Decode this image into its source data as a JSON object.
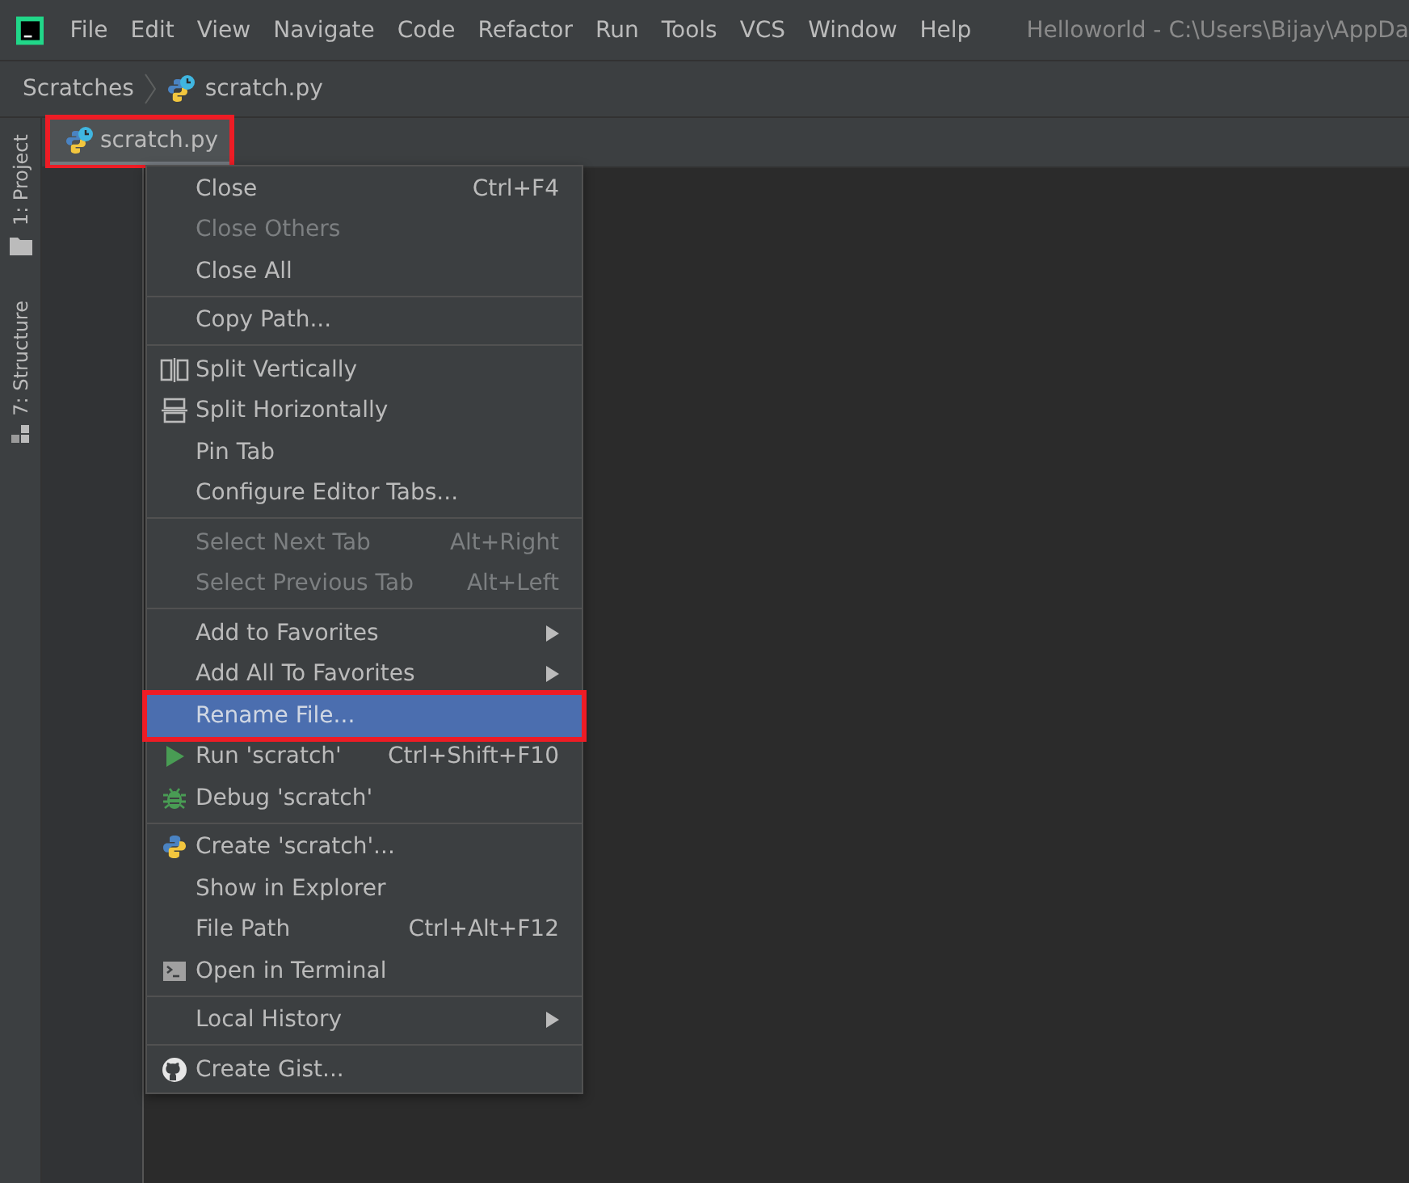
{
  "menu_bar": {
    "items": [
      "File",
      "Edit",
      "View",
      "Navigate",
      "Code",
      "Refactor",
      "Run",
      "Tools",
      "VCS",
      "Window",
      "Help"
    ],
    "window_title": "Helloworld - C:\\Users\\Bijay\\AppDa"
  },
  "breadcrumb": [
    "Scratches",
    "scratch.py"
  ],
  "side_tools": [
    {
      "label": "1: Project",
      "kind": "folder"
    },
    {
      "label": "7: Structure",
      "kind": "structure"
    }
  ],
  "editor_tab": {
    "label": "scratch.py",
    "annotated": true
  },
  "context_menu": [
    {
      "kind": "plain",
      "label": "Close",
      "shortcut": "Ctrl+F4",
      "disabled": false,
      "submenu": false,
      "selected": false,
      "annotated": false
    },
    {
      "kind": "plain",
      "label": "Close Others",
      "disabled": true,
      "submenu": false,
      "selected": false,
      "annotated": false
    },
    {
      "kind": "plain",
      "label": "Close All",
      "disabled": false,
      "submenu": false,
      "selected": false,
      "annotated": false
    },
    {
      "kind": "separator"
    },
    {
      "kind": "plain",
      "label": "Copy Path...",
      "disabled": false,
      "submenu": false,
      "selected": false,
      "annotated": false
    },
    {
      "kind": "separator"
    },
    {
      "kind": "splitv",
      "label": "Split Vertically",
      "disabled": false,
      "submenu": false,
      "selected": false,
      "annotated": false
    },
    {
      "kind": "splith",
      "label": "Split Horizontally",
      "disabled": false,
      "submenu": false,
      "selected": false,
      "annotated": false
    },
    {
      "kind": "plain",
      "label": "Pin Tab",
      "disabled": false,
      "submenu": false,
      "selected": false,
      "annotated": false
    },
    {
      "kind": "plain",
      "label": "Configure Editor Tabs...",
      "disabled": false,
      "submenu": false,
      "selected": false,
      "annotated": false
    },
    {
      "kind": "separator"
    },
    {
      "kind": "plain",
      "label": "Select Next Tab",
      "shortcut": "Alt+Right",
      "disabled": true,
      "submenu": false,
      "selected": false,
      "annotated": false
    },
    {
      "kind": "plain",
      "label": "Select Previous Tab",
      "shortcut": "Alt+Left",
      "disabled": true,
      "submenu": false,
      "selected": false,
      "annotated": false
    },
    {
      "kind": "separator"
    },
    {
      "kind": "plain",
      "label": "Add to Favorites",
      "disabled": false,
      "submenu": true,
      "selected": false,
      "annotated": false
    },
    {
      "kind": "plain",
      "label": "Add All To Favorites",
      "disabled": false,
      "submenu": true,
      "selected": false,
      "annotated": false
    },
    {
      "kind": "plain",
      "label": "Rename File...",
      "disabled": false,
      "submenu": false,
      "selected": true,
      "annotated": true
    },
    {
      "kind": "run",
      "label": "Run 'scratch'",
      "shortcut": "Ctrl+Shift+F10",
      "disabled": false,
      "submenu": false,
      "selected": false,
      "annotated": false
    },
    {
      "kind": "debug",
      "label": "Debug 'scratch'",
      "disabled": false,
      "submenu": false,
      "selected": false,
      "annotated": false
    },
    {
      "kind": "separator"
    },
    {
      "kind": "python",
      "label": "Create 'scratch'...",
      "disabled": false,
      "submenu": false,
      "selected": false,
      "annotated": false
    },
    {
      "kind": "plain",
      "label": "Show in Explorer",
      "disabled": false,
      "submenu": false,
      "selected": false,
      "annotated": false
    },
    {
      "kind": "plain",
      "label": "File Path",
      "shortcut": "Ctrl+Alt+F12",
      "disabled": false,
      "submenu": false,
      "selected": false,
      "annotated": false
    },
    {
      "kind": "terminal",
      "label": "Open in Terminal",
      "disabled": false,
      "submenu": false,
      "selected": false,
      "annotated": false
    },
    {
      "kind": "separator"
    },
    {
      "kind": "plain",
      "label": "Local History",
      "disabled": false,
      "submenu": true,
      "selected": false,
      "annotated": false
    },
    {
      "kind": "separator"
    },
    {
      "kind": "github",
      "label": "Create Gist...",
      "disabled": false,
      "submenu": false,
      "selected": false,
      "annotated": false
    }
  ]
}
